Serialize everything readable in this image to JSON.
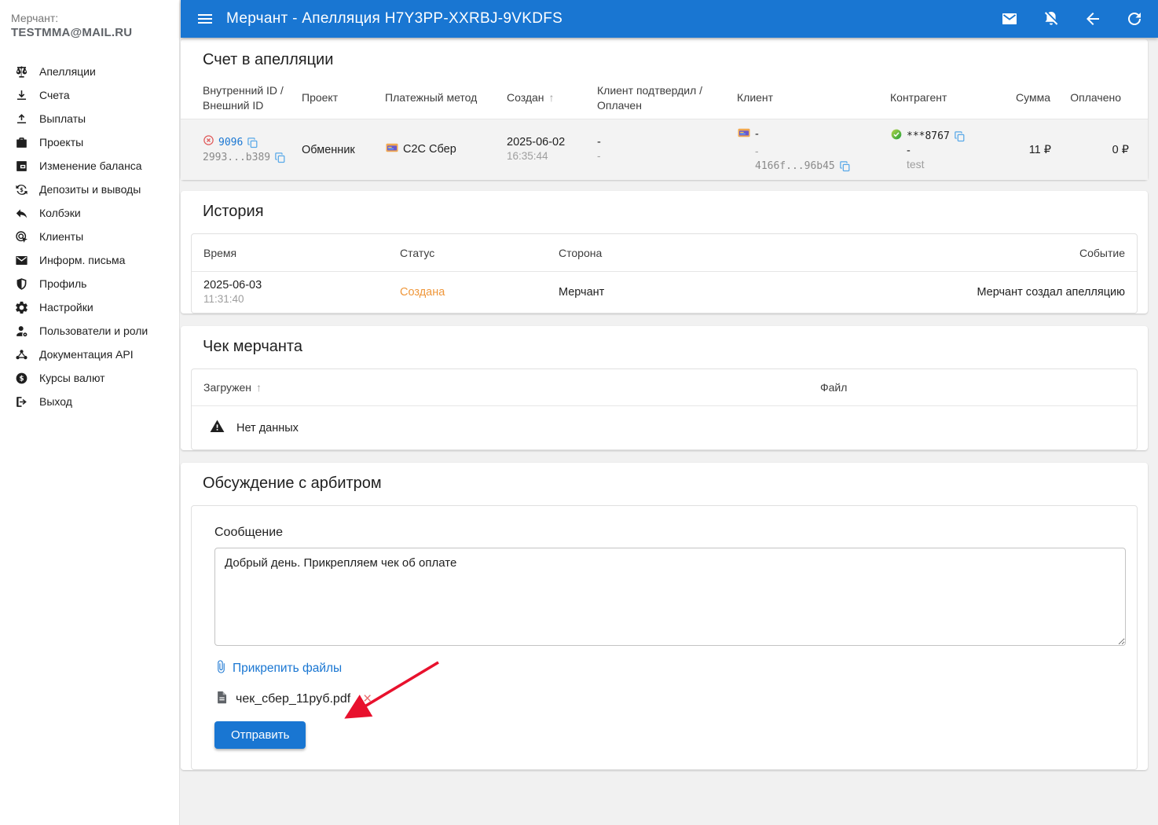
{
  "sidebar": {
    "merchant_label": "Мерчант:",
    "merchant_email": "TESTMMA@MAIL.RU",
    "items": [
      {
        "label": "Апелляции",
        "icon": "scale-icon"
      },
      {
        "label": "Счета",
        "icon": "download-icon"
      },
      {
        "label": "Выплаты",
        "icon": "upload-icon"
      },
      {
        "label": "Проекты",
        "icon": "briefcase-icon"
      },
      {
        "label": "Изменение баланса",
        "icon": "balance-change-icon"
      },
      {
        "label": "Депозиты и выводы",
        "icon": "currency-exchange-icon"
      },
      {
        "label": "Колбэки",
        "icon": "reply-icon"
      },
      {
        "label": "Клиенты",
        "icon": "ads-click-icon"
      },
      {
        "label": "Информ. письма",
        "icon": "mail-icon"
      },
      {
        "label": "Профиль",
        "icon": "shield-icon"
      },
      {
        "label": "Настройки",
        "icon": "gear-icon"
      },
      {
        "label": "Пользователи и роли",
        "icon": "users-roles-icon"
      },
      {
        "label": "Документация API",
        "icon": "hub-icon"
      },
      {
        "label": "Курсы валют",
        "icon": "dollar-circle-icon"
      },
      {
        "label": "Выход",
        "icon": "logout-icon"
      }
    ]
  },
  "header": {
    "title": "Мерчант - Апелляция H7Y3PP-XXRBJ-9VKDFS",
    "icons": [
      "menu-icon",
      "mail-icon",
      "notifications-off-icon",
      "back-icon",
      "refresh-icon"
    ]
  },
  "invoice_section": {
    "title": "Счет в апелляции",
    "columns": {
      "c1": "Внутренний ID / Внешний ID",
      "c2": "Проект",
      "c3": "Платежный метод",
      "c4": "Создан",
      "c5": "Клиент подтвердил / Оплачен",
      "c6": "Клиент",
      "c7": "Контрагент",
      "c8": "Сумма",
      "c9": "Оплачено"
    },
    "row": {
      "internal_id": "9096",
      "external_id": "2993...b389",
      "project": "Обменник",
      "payment_method": "C2C Сбер",
      "created_date": "2025-06-02",
      "created_time": "16:35:44",
      "client_confirmed": "-",
      "paid_flag": "-",
      "client_line1": "-",
      "client_line2": "-",
      "client_id": "4166f...96b45",
      "counterparty_card": "***8767",
      "counterparty_line2": "-",
      "counterparty_name": "test",
      "amount": "11 ₽",
      "paid_amount": "0 ₽"
    }
  },
  "history_section": {
    "title": "История",
    "columns": {
      "time": "Время",
      "status": "Статус",
      "side": "Сторона",
      "event": "Событие"
    },
    "row": {
      "date": "2025-06-03",
      "time": "11:31:40",
      "status": "Создана",
      "side": "Мерчант",
      "event": "Мерчант создал апелляцию"
    }
  },
  "receipt_section": {
    "title": "Чек мерчанта",
    "columns": {
      "uploaded": "Загружен",
      "file": "Файл"
    },
    "empty_text": "Нет данных"
  },
  "discussion_section": {
    "title": "Обсуждение с арбитром",
    "message_label": "Сообщение",
    "message_value": "Добрый день. Прикрепляем чек об оплате",
    "attach_link": "Прикрепить файлы",
    "file_name": "чек_сбер_11руб.pdf",
    "remove_file_glyph": "×",
    "send_button": "Отправить"
  },
  "colors": {
    "appbar": "#1976d2",
    "link": "#1976d2",
    "status_created": "#ef973b",
    "row_highlight": "#f3f3f3",
    "annotation_arrow": "#e8112d",
    "copy_icon": "#57a8e8",
    "error_icon": "#e05b5b",
    "success_icon": "#21a038"
  }
}
